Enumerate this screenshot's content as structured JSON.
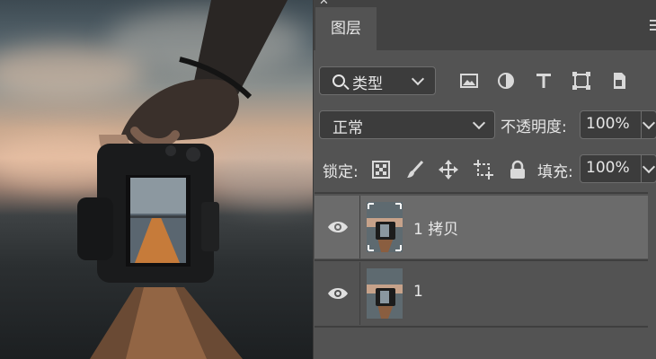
{
  "panel": {
    "tab_label": "图层",
    "filter": {
      "label": "类型",
      "icon": "search-icon"
    },
    "filter_icons": [
      "image-filter-icon",
      "adjustment-filter-icon",
      "text-filter-icon",
      "shape-filter-icon",
      "smart-object-filter-icon"
    ],
    "blend_mode": "正常",
    "opacity_label": "不透明度:",
    "opacity_value": "100%",
    "lock_label": "锁定:",
    "lock_icons": [
      "lock-transparent-pixels-icon",
      "lock-image-pixels-icon",
      "lock-position-icon",
      "lock-artboard-icon",
      "lock-all-icon"
    ],
    "fill_label": "填充:",
    "fill_value": "100%"
  },
  "layers": [
    {
      "name": "1 拷贝",
      "selected": true,
      "visible": true
    },
    {
      "name": "1",
      "selected": false,
      "visible": true
    }
  ],
  "colors": {
    "panel_bg": "#535353",
    "tabbar_bg": "#424242",
    "selected_row": "#6b6b6b",
    "field_bg": "#3c3c3c"
  }
}
